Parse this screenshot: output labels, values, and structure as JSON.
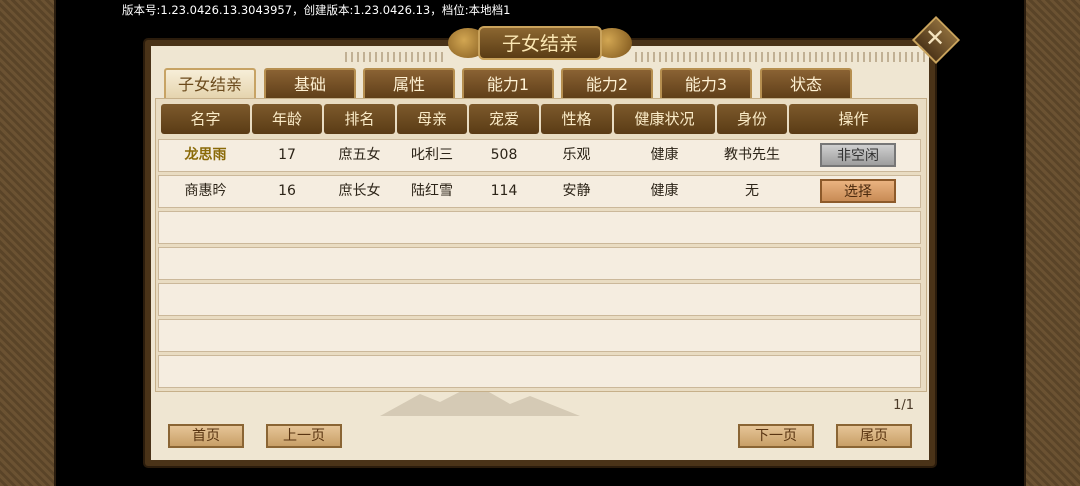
{
  "version_text": "版本号:1.23.0426.13.3043957，创建版本:1.23.0426.13，档位:本地档1",
  "title": "子女结亲",
  "close_icon": "close-x-icon",
  "tabs": [
    "子女结亲",
    "基础",
    "属性",
    "能力1",
    "能力2",
    "能力3",
    "状态"
  ],
  "columns": [
    "名字",
    "年龄",
    "排名",
    "母亲",
    "宠爱",
    "性格",
    "健康状况",
    "身份",
    "操作"
  ],
  "rows": [
    {
      "name": "龙思雨",
      "age": "17",
      "rank": "庶五女",
      "mother": "叱利三",
      "favor": "508",
      "personality": "乐观",
      "health": "健康",
      "identity": "教书先生",
      "action": "非空闲"
    },
    {
      "name": "商惠昑",
      "age": "16",
      "rank": "庶长女",
      "mother": "陆红雪",
      "favor": "114",
      "personality": "安静",
      "health": "健康",
      "identity": "无",
      "action": "选择"
    }
  ],
  "page_count": "1/1",
  "nav": {
    "first": "首页",
    "prev": "上一页",
    "next": "下一页",
    "last": "尾页"
  }
}
